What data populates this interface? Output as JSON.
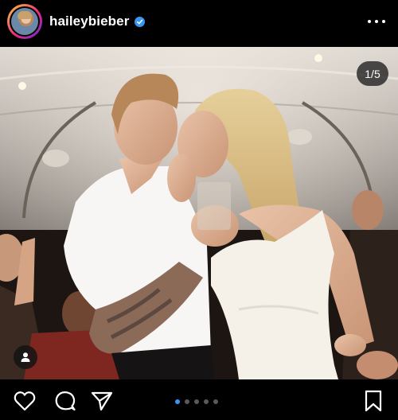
{
  "header": {
    "username": "haileybieber",
    "verified_icon": "verified-badge-icon",
    "more_icon": "more-options-icon"
  },
  "photo": {
    "counter": "1/5",
    "tag_icon": "user-tag-icon"
  },
  "carousel": {
    "total": 5,
    "active_index": 0,
    "active_color": "#3897f0",
    "inactive_color": "#5a5a5a"
  },
  "actions": {
    "like_icon": "heart-icon",
    "comment_icon": "comment-icon",
    "share_icon": "send-icon",
    "save_icon": "bookmark-icon"
  }
}
